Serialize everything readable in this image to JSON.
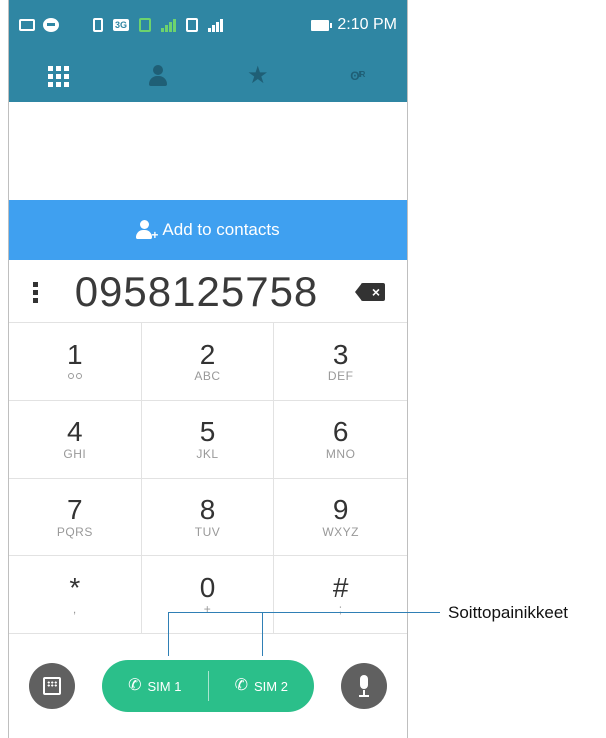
{
  "status_bar": {
    "time": "2:10 PM",
    "network_badge": "3G"
  },
  "tabs": [
    {
      "name": "dialpad",
      "icon": "dialpad-grid-icon",
      "active": true
    },
    {
      "name": "contacts",
      "icon": "person-icon"
    },
    {
      "name": "favorites",
      "icon": "star-icon"
    },
    {
      "name": "groups",
      "icon": "group-icon",
      "glyph": "ʘᴵᴿ"
    }
  ],
  "add_contacts": {
    "label": "Add to contacts",
    "icon": "add-person-icon"
  },
  "dialer": {
    "number": "0958125758"
  },
  "keypad": [
    {
      "digit": "1",
      "letters": ""
    },
    {
      "digit": "2",
      "letters": "ABC"
    },
    {
      "digit": "3",
      "letters": "DEF"
    },
    {
      "digit": "4",
      "letters": "GHI"
    },
    {
      "digit": "5",
      "letters": "JKL"
    },
    {
      "digit": "6",
      "letters": "MNO"
    },
    {
      "digit": "7",
      "letters": "PQRS"
    },
    {
      "digit": "8",
      "letters": "TUV"
    },
    {
      "digit": "9",
      "letters": "WXYZ"
    },
    {
      "digit": "*",
      "letters": ","
    },
    {
      "digit": "0",
      "letters": "+"
    },
    {
      "digit": "#",
      "letters": ";"
    }
  ],
  "call_buttons": {
    "sim1_label": "SIM 1",
    "sim2_label": "SIM 2"
  },
  "annotation": {
    "label": "Soittopainikkeet"
  },
  "colors": {
    "header": "#2f86a3",
    "add_bar": "#3fa0f0",
    "call_green": "#2bbf8a",
    "callout": "#2f7fb5"
  }
}
